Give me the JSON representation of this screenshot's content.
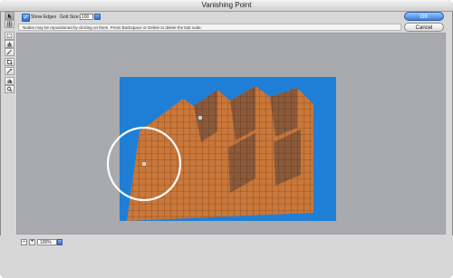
{
  "window": {
    "title": "Vanishing Point"
  },
  "options": {
    "show_edges_label": "Show Edges",
    "show_edges_checked": true,
    "grid_size_label": "Grid Size:",
    "grid_size_value": "100"
  },
  "hint": {
    "text": "Nodes may be repositioned by clicking on them. Press Backspace or Delete to delete the last node."
  },
  "buttons": {
    "ok": "OK",
    "cancel": "Cancel"
  },
  "tools": [
    "edit-plane",
    "create-plane",
    "marquee",
    "stamp",
    "brush",
    "transform",
    "eyedropper",
    "hand",
    "zoom"
  ],
  "zoom": {
    "minus": "–",
    "plus": "+",
    "value": "100%"
  },
  "colors": {
    "sky": "#1f7fd6",
    "building": "#c9773a",
    "canvas": "#a9aaad",
    "accent": "#3c7ddd"
  }
}
